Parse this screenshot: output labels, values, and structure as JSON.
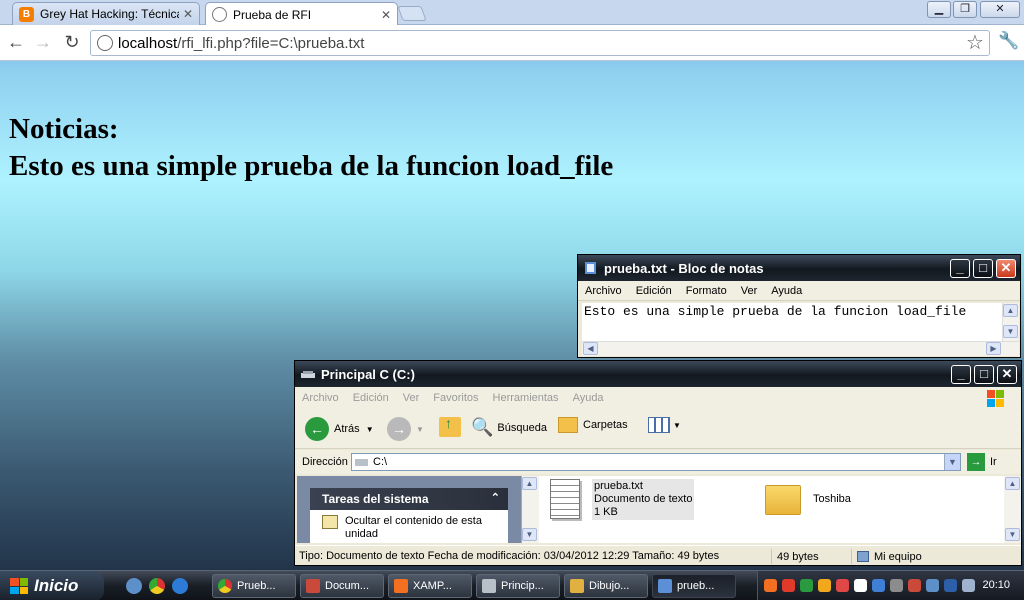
{
  "browser": {
    "tabs": [
      {
        "title": "Grey Hat Hacking: Técnicas Av",
        "icon": "blogger-icon"
      },
      {
        "title": "Prueba de RFI",
        "icon": "globe-icon",
        "active": true
      }
    ],
    "url_host": "localhost",
    "url_path": "/rfi_lfi.php?file=C:\\prueba.txt"
  },
  "page": {
    "line1": "Noticias:",
    "line2": "Esto es una simple prueba de la funcion load_file"
  },
  "notepad": {
    "title": "prueba.txt - Bloc de notas",
    "menu": [
      "Archivo",
      "Edición",
      "Formato",
      "Ver",
      "Ayuda"
    ],
    "content": "Esto es una simple prueba de la funcion load_file"
  },
  "explorer": {
    "title": "Principal C (C:)",
    "menu": [
      "Archivo",
      "Edición",
      "Ver",
      "Favoritos",
      "Herramientas",
      "Ayuda"
    ],
    "toolbar": {
      "back": "Atrás",
      "search": "Búsqueda",
      "folders": "Carpetas"
    },
    "address_label": "Dirección",
    "address_value": "C:\\",
    "go_label": "Ir",
    "tasks_title": "Tareas del sistema",
    "task_item": "Ocultar el contenido de esta unidad",
    "files": [
      {
        "name": "prueba.txt",
        "type": "Documento de texto",
        "size": "1 KB"
      },
      {
        "name": "Toshiba"
      }
    ],
    "status_main": "Tipo: Documento de texto Fecha de modificación: 03/04/2012 12:29 Tamaño: 49 bytes",
    "status_size": "49 bytes",
    "status_location": "Mi equipo"
  },
  "taskbar": {
    "start": "Inicio",
    "tasks": [
      "Prueb...",
      "Docum...",
      "XAMP...",
      "Princip...",
      "Dibujo...",
      "prueb..."
    ],
    "clock": "20:10"
  },
  "colors": {
    "close": "#c9391b",
    "title_dark": "#12181f",
    "accent": "#1a8c3a"
  }
}
